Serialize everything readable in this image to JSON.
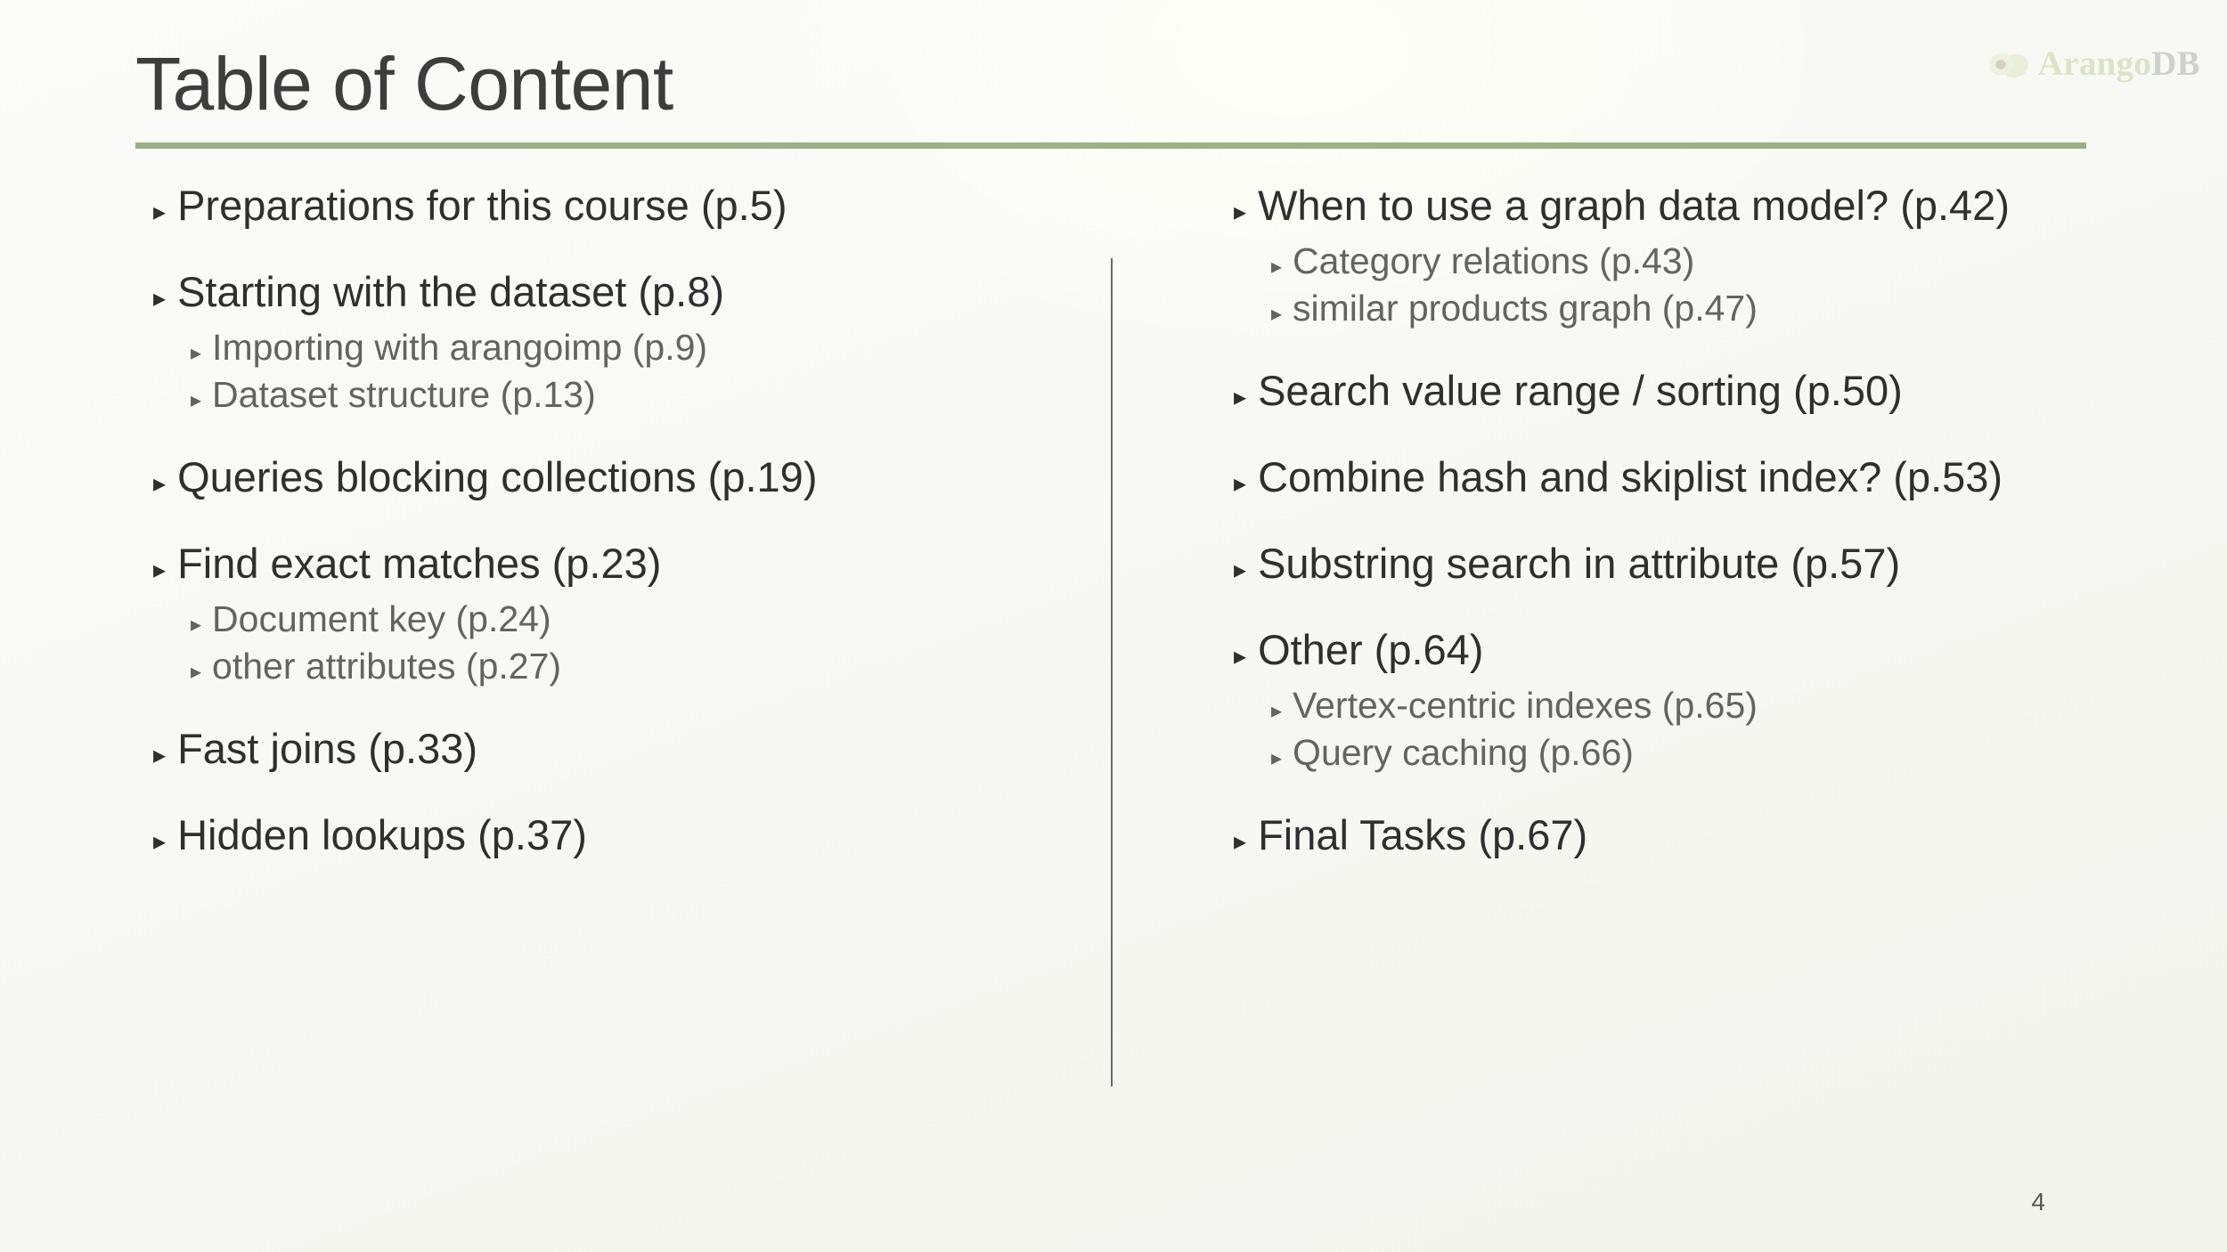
{
  "header": {
    "title": "Table of Content",
    "rule_color": "#85a06d"
  },
  "logo": {
    "name_part1": "Arango",
    "name_part2": "DB",
    "icon": "avocado-icon",
    "color_part1": "#9fb964",
    "color_part2": "#6e7572"
  },
  "columns": {
    "left": [
      {
        "label": "Preparations for this course (p.5)",
        "children": []
      },
      {
        "label": "Starting with the dataset (p.8)",
        "children": [
          "Importing with arangoimp (p.9)",
          "Dataset structure (p.13)"
        ]
      },
      {
        "label": "Queries blocking collections (p.19)",
        "children": []
      },
      {
        "label": "Find exact matches (p.23)",
        "children": [
          "Document key (p.24)",
          "other attributes (p.27)"
        ]
      },
      {
        "label": "Fast joins (p.33)",
        "children": []
      },
      {
        "label": "Hidden lookups (p.37)",
        "children": []
      }
    ],
    "right": [
      {
        "label": "When to use a graph data model? (p.42)",
        "children": [
          "Category relations (p.43)",
          "similar products graph (p.47)"
        ]
      },
      {
        "label": "Search value range / sorting (p.50)",
        "children": []
      },
      {
        "label": "Combine hash and skiplist index? (p.53)",
        "children": []
      },
      {
        "label": "Substring search in attribute (p.57)",
        "children": []
      },
      {
        "label": "Other (p.64)",
        "children": [
          "Vertex-centric indexes (p.65)",
          "Query caching (p.66)"
        ]
      },
      {
        "label": "Final Tasks (p.67)",
        "children": []
      }
    ]
  },
  "bullet_marker": "▸",
  "footer": {
    "page_number": "4"
  }
}
